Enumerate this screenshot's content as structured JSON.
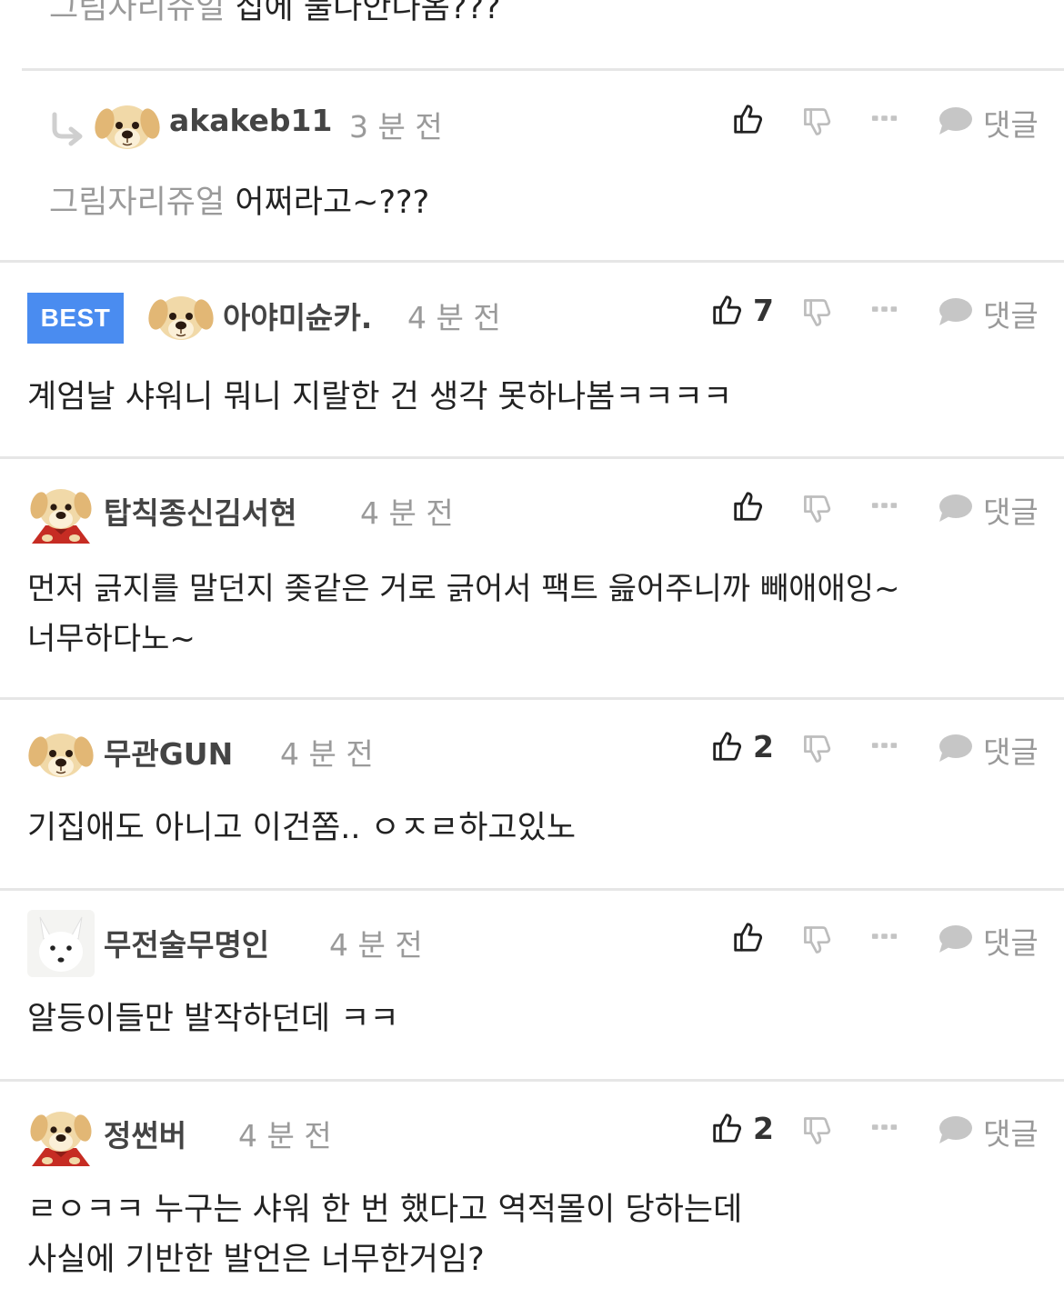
{
  "top_partial": {
    "mention": "그림자리쥬얼",
    "text": "집에 불나안나옴???"
  },
  "reply": {
    "author": "akakeb11",
    "time": "3 분 전",
    "mention": "그림자리쥬얼",
    "text": "어쩌라고~???",
    "reply_label": "댓글"
  },
  "comments": [
    {
      "badge": "BEST",
      "author": "아야미슌카.",
      "time": "4 분 전",
      "likes": "7",
      "lines": [
        "계엄날 샤워니 뭐니 지랄한 건 생각 못하나봄ㅋㅋㅋㅋ"
      ],
      "reply_label": "댓글"
    },
    {
      "author": "탑칙종신김서현",
      "time": "4 분 전",
      "likes": "",
      "lines": [
        "먼저 긁지를 말던지 좆같은 거로 긁어서 팩트 읊어주니까 빼애애잉~",
        "너무하다노~"
      ],
      "reply_label": "댓글"
    },
    {
      "author": "무관GUN",
      "time": "4 분 전",
      "likes": "2",
      "lines": [
        "기집애도 아니고 이건쫌.. ㅇㅈㄹ하고있노"
      ],
      "reply_label": "댓글"
    },
    {
      "author": "무전술무명인",
      "time": "4 분 전",
      "likes": "",
      "lines": [
        "알등이들만 발작하던데 ㅋㅋ"
      ],
      "reply_label": "댓글"
    },
    {
      "author": "정썬버",
      "time": "4 분 전",
      "likes": "2",
      "lines": [
        "ㄹㅇㅋㅋ 누구는 샤워 한 번 했다고 역적몰이 당하는데",
        "사실에 기반한 발언은 너무한거임?"
      ],
      "reply_label": "댓글"
    }
  ],
  "icons": {
    "like": "thumbs-up-icon",
    "dislike": "thumbs-down-icon",
    "more": "more-dots-icon",
    "reply": "speech-bubble-icon",
    "reply_arrow": "reply-arrow-icon"
  },
  "colors": {
    "best_badge": "#4a8cf0",
    "muted": "#9a9a9a",
    "divider": "#e6e6e6"
  }
}
